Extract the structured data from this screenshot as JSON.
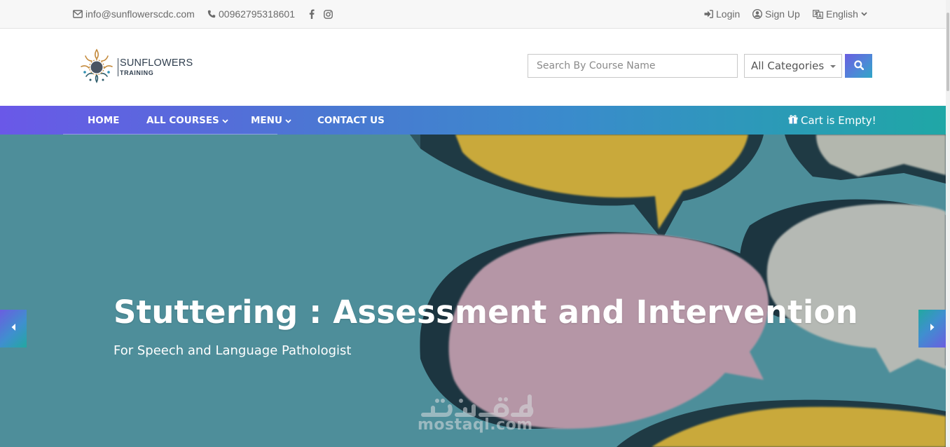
{
  "topbar": {
    "email": "info@sunflowerscdc.com",
    "phone": "00962795318601",
    "social": [
      "facebook-icon",
      "instagram-icon"
    ],
    "login": "Login",
    "signup": "Sign Up",
    "language": "English"
  },
  "logo": {
    "line1": "SUNFLOWERS",
    "line2": "TRAINING"
  },
  "search": {
    "placeholder": "Search By Course Name",
    "category_selected": "All Categories"
  },
  "nav": {
    "items": [
      {
        "label": "HOME",
        "has_dropdown": false
      },
      {
        "label": "ALL COURSES",
        "has_dropdown": true
      },
      {
        "label": "MENU",
        "has_dropdown": true
      },
      {
        "label": "CONTACT US",
        "has_dropdown": false
      }
    ],
    "cart": "Cart is Empty!"
  },
  "hero": {
    "title": "Stuttering : Assessment and Intervention",
    "subtitle": "For Speech and Language Pathologist"
  },
  "watermark": {
    "latin": "mostaql.com"
  },
  "colors": {
    "accent_purple": "#6a58e8",
    "accent_teal": "#1fa7a6",
    "hero_bg": "#4d8e9a",
    "bubble_yellow": "#c9a93a",
    "bubble_pink": "#b596a6",
    "bubble_grey": "#b5b9b4"
  }
}
